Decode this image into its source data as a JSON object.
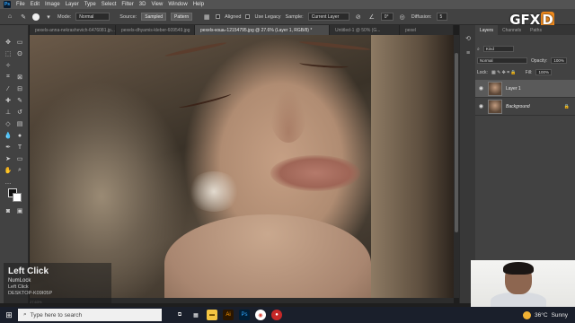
{
  "menubar": {
    "logo": "Ps",
    "items": [
      "File",
      "Edit",
      "Image",
      "Layer",
      "Type",
      "Select",
      "Filter",
      "3D",
      "View",
      "Window",
      "Help"
    ]
  },
  "options": {
    "mode_label": "Mode:",
    "mode_value": "Normal",
    "source_label": "Source:",
    "source_sampled": "Sampled",
    "source_pattern": "Pattern",
    "aligned_label": "Aligned",
    "legacy_label": "Use Legacy",
    "sample_label": "Sample:",
    "sample_value": "Current Layer",
    "angle_value": "0°",
    "diffusion_label": "Diffusion:",
    "diffusion_value": "5"
  },
  "doc_tabs": [
    "pexels-anna-nekrashevich-6476081.jp...",
    "pexels-dhyamis-kleber-609549.jpg",
    "pexels-кошь-12154795.jpg @ 27.6% (Layer 1, RGB/8) *",
    "Untitled-1 @ 50% (G...",
    "pexel"
  ],
  "layers_panel": {
    "tabs": [
      "Layers",
      "Channels",
      "Paths"
    ],
    "kind_label": "Kind",
    "blend_mode": "Normal",
    "opacity_label": "Opacity:",
    "opacity_value": "100%",
    "lock_label": "Lock:",
    "fill_label": "Fill:",
    "fill_value": "100%",
    "layers": [
      {
        "name": "Layer 1",
        "selected": true
      },
      {
        "name": "Background",
        "selected": false
      }
    ]
  },
  "watermark": {
    "text": "GFX",
    "accent": "D"
  },
  "status": {
    "zoom": "27.63%"
  },
  "keycast": {
    "title": "Left Click",
    "line1": "NumLock",
    "line2": "Left Click",
    "machine": "DESKTOP-K09I05P"
  },
  "taskbar": {
    "search_placeholder": "Type here to search",
    "weather_temp": "36°C",
    "weather_desc": "Sunny"
  },
  "colors": {
    "ui_dark": "#424242",
    "menubar": "#535353",
    "ps_blue": "#31a8ff",
    "gfx_orange": "#f08a1c",
    "taskbar": "#1a1f2b"
  }
}
